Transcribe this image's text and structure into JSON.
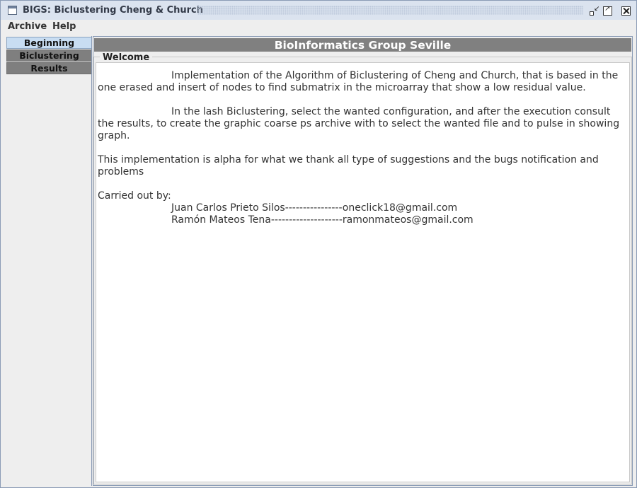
{
  "window": {
    "title": "BIGS: Biclustering Cheng & Church"
  },
  "menubar": {
    "items": [
      "Archive",
      "Help"
    ]
  },
  "tabs": [
    {
      "label": "Beginning",
      "active": true
    },
    {
      "label": "Biclustering",
      "active": false
    },
    {
      "label": "Results",
      "active": false
    }
  ],
  "content": {
    "banner": "BioInformatics Group Seville",
    "panel_title": "Welcome",
    "para1": "Implementation of the Algorithm of Biclustering of Cheng and Church, that is based in the one erased and insert of nodes to find submatrix in the microarray that show a low residual value.",
    "para2": "In the lash Biclustering, select the wanted configuration, and after the execution consult the results, to create the graphic coarse ps archive with to select the wanted file and to pulse in showing graph.",
    "para3": "This implementation is alpha for what we thank all type of suggestions and the bugs notification and problems",
    "carried_out_by": "Carried out by:",
    "author1": "Juan Carlos Prieto Silos----------------oneclick18@gmail.com",
    "author2": "Ramón Mateos Tena--------------------ramonmateos@gmail.com"
  },
  "colors": {
    "banner_bg": "#808080",
    "active_tab_bg": "#c8ddf2",
    "inactive_tab_bg": "#7f7f7f",
    "titlebar_bg": "#dbe3ef"
  }
}
